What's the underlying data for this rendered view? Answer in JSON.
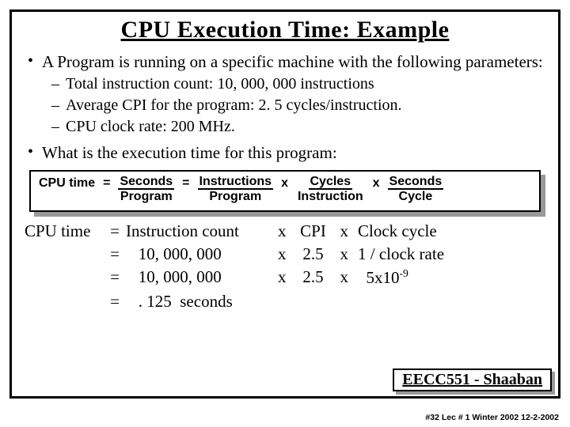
{
  "title": "CPU Execution Time: Example",
  "bullets": {
    "b1a": "A Program is running on a specific machine with the following parameters:",
    "sub1": "Total instruction count:     10, 000, 000 instructions",
    "sub2": "Average CPI for the program:   2. 5  cycles/instruction.",
    "sub3": "CPU clock rate:  200 MHz.",
    "b1b": "What is the execution time for this program:"
  },
  "formula": {
    "lhs": "CPU time",
    "eq1": "=",
    "f1n": "Seconds",
    "f1d": "Program",
    "eq2": "=",
    "f2n": "Instructions",
    "f2d": "Program",
    "x1": "x",
    "f3n": "Cycles",
    "f3d": "Instruction",
    "x2": "x",
    "f4n": "Seconds",
    "f4d": "Cycle"
  },
  "calc": {
    "r1": {
      "lhs": "CPU time",
      "eq": "=",
      "c1": "Instruction count",
      "x1": "x",
      "c2": "CPI",
      "x2": "x",
      "c3": "Clock cycle"
    },
    "r2": {
      "lhs": "",
      "eq": "=",
      "c1": "   10, 000, 000",
      "x1": "x",
      "c2": "2.5",
      "x2": "x",
      "c3": "1 / clock rate"
    },
    "r3": {
      "lhs": "",
      "eq": "=",
      "c1": "   10, 000, 000",
      "x1": "x",
      "c2": "2.5",
      "x2": "x",
      "c3_a": "  5x10",
      "c3_sup": "-9"
    },
    "r4": {
      "lhs": "",
      "eq": "=",
      "c1": "   . 125  seconds"
    }
  },
  "course": "EECC551 - Shaaban",
  "footer": "#32   Lec # 1 Winter 2002   12-2-2002"
}
